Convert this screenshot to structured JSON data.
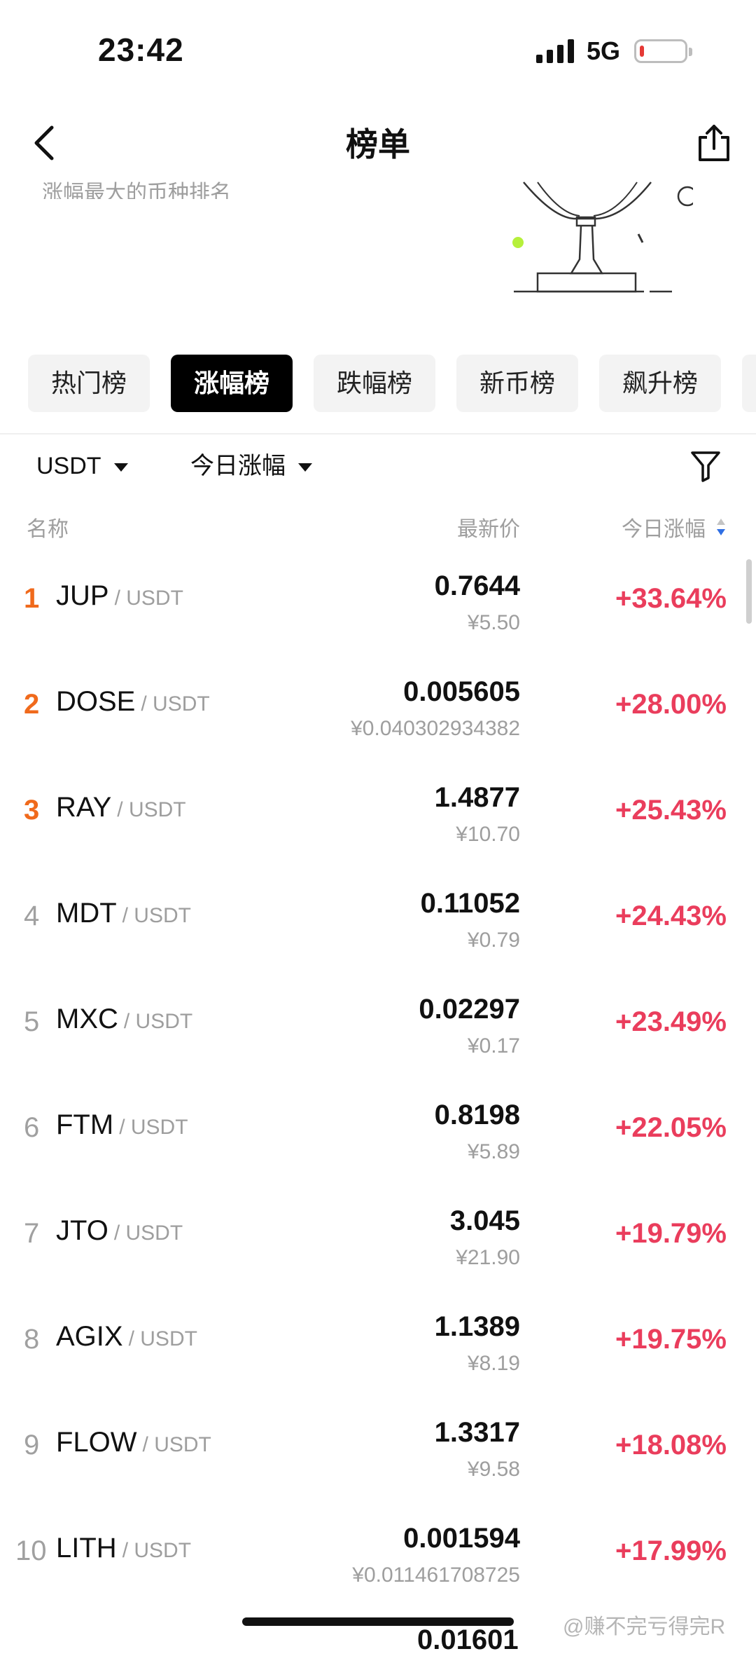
{
  "status_bar": {
    "time": "23:42",
    "network": "5G"
  },
  "header": {
    "title": "榜单",
    "subtitle": "涨幅最大的币种排名"
  },
  "tabs": [
    {
      "label": "热门榜",
      "active": false
    },
    {
      "label": "涨幅榜",
      "active": true
    },
    {
      "label": "跌幅榜",
      "active": false
    },
    {
      "label": "新币榜",
      "active": false
    },
    {
      "label": "飙升榜",
      "active": false
    }
  ],
  "filters": {
    "quote_currency": "USDT",
    "period": "今日涨幅"
  },
  "columns": {
    "name": "名称",
    "price": "最新价",
    "change": "今日涨幅"
  },
  "rows": [
    {
      "rank": "1",
      "symbol": "JUP",
      "quote": "/ USDT",
      "price": "0.7644",
      "cny": "¥5.50",
      "change": "+33.64%"
    },
    {
      "rank": "2",
      "symbol": "DOSE",
      "quote": "/ USDT",
      "price": "0.005605",
      "cny": "¥0.040302934382",
      "change": "+28.00%"
    },
    {
      "rank": "3",
      "symbol": "RAY",
      "quote": "/ USDT",
      "price": "1.4877",
      "cny": "¥10.70",
      "change": "+25.43%"
    },
    {
      "rank": "4",
      "symbol": "MDT",
      "quote": "/ USDT",
      "price": "0.11052",
      "cny": "¥0.79",
      "change": "+24.43%"
    },
    {
      "rank": "5",
      "symbol": "MXC",
      "quote": "/ USDT",
      "price": "0.02297",
      "cny": "¥0.17",
      "change": "+23.49%"
    },
    {
      "rank": "6",
      "symbol": "FTM",
      "quote": "/ USDT",
      "price": "0.8198",
      "cny": "¥5.89",
      "change": "+22.05%"
    },
    {
      "rank": "7",
      "symbol": "JTO",
      "quote": "/ USDT",
      "price": "3.045",
      "cny": "¥21.90",
      "change": "+19.79%"
    },
    {
      "rank": "8",
      "symbol": "AGIX",
      "quote": "/ USDT",
      "price": "1.1389",
      "cny": "¥8.19",
      "change": "+19.75%"
    },
    {
      "rank": "9",
      "symbol": "FLOW",
      "quote": "/ USDT",
      "price": "1.3317",
      "cny": "¥9.58",
      "change": "+18.08%"
    },
    {
      "rank": "10",
      "symbol": "LITH",
      "quote": "/ USDT",
      "price": "0.001594",
      "cny": "¥0.011461708725",
      "change": "+17.99%"
    }
  ],
  "next_row_partial": "0.01601",
  "watermark": "@赚不完亏得完R",
  "icons": {
    "back": "chevron-left-icon",
    "share": "share-icon",
    "filter": "funnel-icon",
    "sort": "sort-icon",
    "signal": "signal-icon",
    "battery": "battery-icon",
    "trophy": "trophy-illustration"
  },
  "colors": {
    "positive": "#ea3d5c",
    "top_rank": "#f06a1c",
    "active_tab": "#000000",
    "sort_active": "#2f6fe4"
  }
}
